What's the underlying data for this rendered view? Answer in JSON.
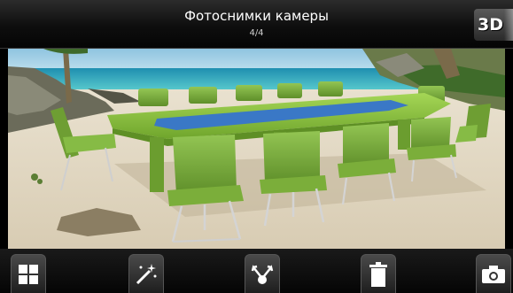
{
  "header": {
    "title": "Фотоснимки камеры",
    "counter": "4/4",
    "mode_button_label": "3D"
  },
  "photo": {
    "description_icon": "photo-image"
  },
  "toolbar": {
    "items": [
      {
        "name": "grid-view-button",
        "icon": "grid-icon"
      },
      {
        "name": "effects-button",
        "icon": "magic-wand-icon"
      },
      {
        "name": "share-button",
        "icon": "share-icon"
      },
      {
        "name": "delete-button",
        "icon": "trash-icon"
      },
      {
        "name": "camera-button",
        "icon": "camera-icon"
      }
    ]
  },
  "colors": {
    "titlebar_bg": "#0e0e0e",
    "chair_green": "#7fb43a",
    "table_green": "#8cc63f",
    "table_blue": "#3d7cc9",
    "sky": "#bfe0ef",
    "sea": "#2aa9bd",
    "sand": "#e6ddc9"
  }
}
